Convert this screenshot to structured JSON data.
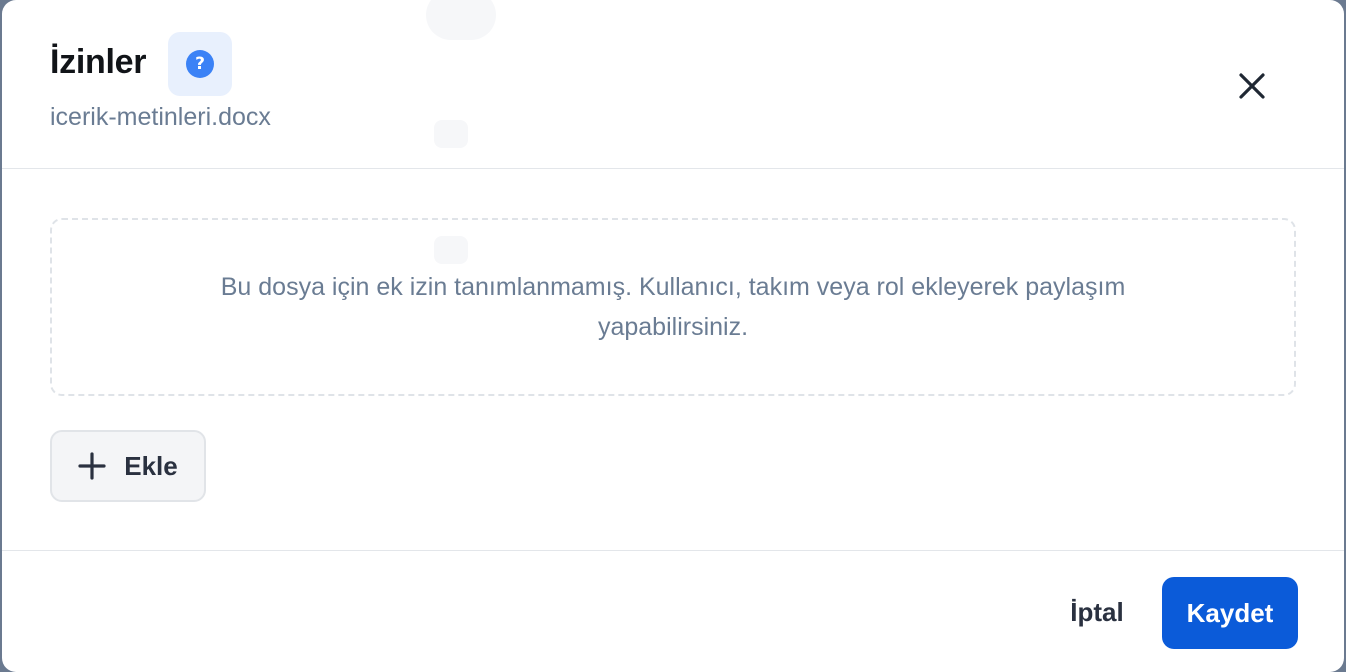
{
  "dialog": {
    "title": "İzinler",
    "help_icon": "question-mark-icon",
    "help_symbol": "?",
    "file_name": "icerik-metinleri.docx",
    "close_icon": "close-icon"
  },
  "permissions": {
    "empty_message": "Bu dosya için ek izin tanımlanmamış. Kullanıcı, takım veya rol ekleyerek paylaşım yapabilirsiniz.",
    "add_button_label": "Ekle",
    "add_icon": "plus-icon"
  },
  "footer": {
    "cancel_label": "İptal",
    "save_label": "Kaydet"
  },
  "colors": {
    "primary": "#0b5bd9",
    "help_accent": "#3b82f6",
    "muted_text": "#6a7c93"
  }
}
